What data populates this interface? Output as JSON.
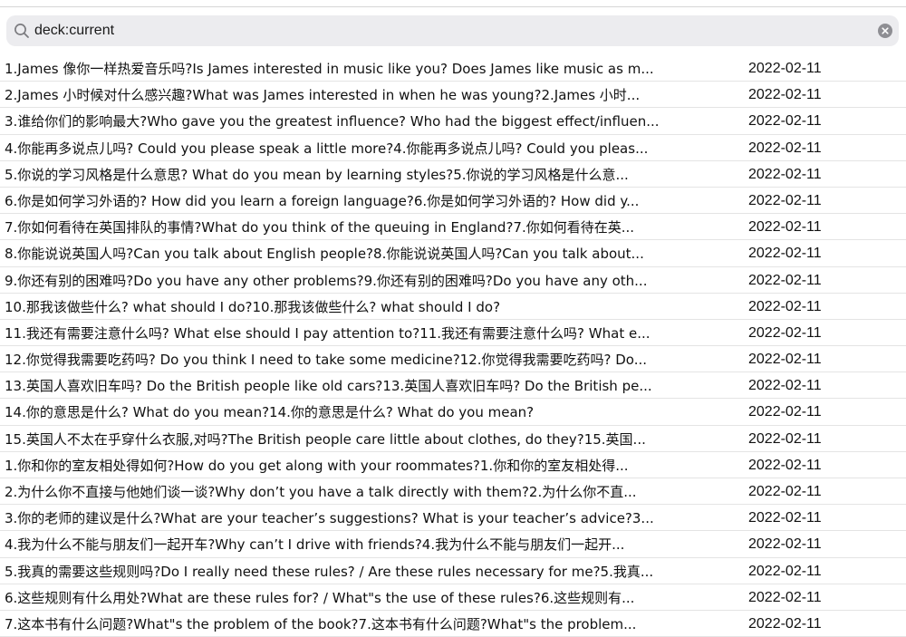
{
  "search": {
    "value": "deck:current"
  },
  "rows": [
    {
      "question": "1.James 像你一样热爱音乐吗?Is James interested in music like you? Does James like music as m...",
      "date": "2022-02-11"
    },
    {
      "question": "2.James 小时候对什么感兴趣?What was James interested in when he was young?2.James 小时...",
      "date": "2022-02-11"
    },
    {
      "question": "3.谁给你们的影响最大?Who gave you the greatest influence? Who had the biggest effect/influen...",
      "date": "2022-02-11"
    },
    {
      "question": "4.你能再多说点儿吗? Could you please speak a little more?4.你能再多说点儿吗? Could you pleas...",
      "date": "2022-02-11"
    },
    {
      "question": "5.你说的学习风格是什么意思? What do you mean by learning styles?5.你说的学习风格是什么意...",
      "date": "2022-02-11"
    },
    {
      "question": "6.你是如何学习外语的? How did you learn a foreign language?6.你是如何学习外语的? How did y...",
      "date": "2022-02-11"
    },
    {
      "question": "7.你如何看待在英国排队的事情?What do you think of the queuing in England?7.你如何看待在英...",
      "date": "2022-02-11"
    },
    {
      "question": "8.你能说说英国人吗?Can you talk about English people?8.你能说说英国人吗?Can you talk about...",
      "date": "2022-02-11"
    },
    {
      "question": "9.你还有别的困难吗?Do you have any other problems?9.你还有别的困难吗?Do you have any oth...",
      "date": "2022-02-11"
    },
    {
      "question": "10.那我该做些什么? what should I do?10.那我该做些什么? what should I do?",
      "date": "2022-02-11"
    },
    {
      "question": "11.我还有需要注意什么吗? What else should I pay attention to?11.我还有需要注意什么吗? What e...",
      "date": "2022-02-11"
    },
    {
      "question": "12.你觉得我需要吃药吗? Do you think I need to take some medicine?12.你觉得我需要吃药吗? Do...",
      "date": "2022-02-11"
    },
    {
      "question": "13.英国人喜欢旧车吗? Do the British people like old cars?13.英国人喜欢旧车吗? Do the British pe...",
      "date": "2022-02-11"
    },
    {
      "question": "14.你的意思是什么? What do you mean?14.你的意思是什么? What do you mean?",
      "date": "2022-02-11"
    },
    {
      "question": "15.英国人不太在乎穿什么衣服,对吗?The British people care little about clothes, do they?15.英国...",
      "date": "2022-02-11"
    },
    {
      "question": "1.你和你的室友相处得如何?How do you get along with your roommates?1.你和你的室友相处得...",
      "date": "2022-02-11"
    },
    {
      "question": "2.为什么你不直接与他她们谈一谈?Why don’t you have a talk directly with them?2.为什么你不直...",
      "date": "2022-02-11"
    },
    {
      "question": "3.你的老师的建议是什么?What are your teacher’s suggestions? What is your teacher’s advice?3...",
      "date": "2022-02-11"
    },
    {
      "question": "4.我为什么不能与朋友们一起开车?Why can’t I drive with friends?4.我为什么不能与朋友们一起开...",
      "date": "2022-02-11"
    },
    {
      "question": "5.我真的需要这些规则吗?Do I really need these rules? / Are these rules necessary for me?5.我真...",
      "date": "2022-02-11"
    },
    {
      "question": "6.这些规则有什么用处?What are these rules for? / What\"s the use of these rules?6.这些规则有...",
      "date": "2022-02-11"
    },
    {
      "question": "7.这本书有什么问题?What\"s the problem of the book?7.这本书有什么问题?What\"s the problem...",
      "date": "2022-02-11"
    }
  ]
}
